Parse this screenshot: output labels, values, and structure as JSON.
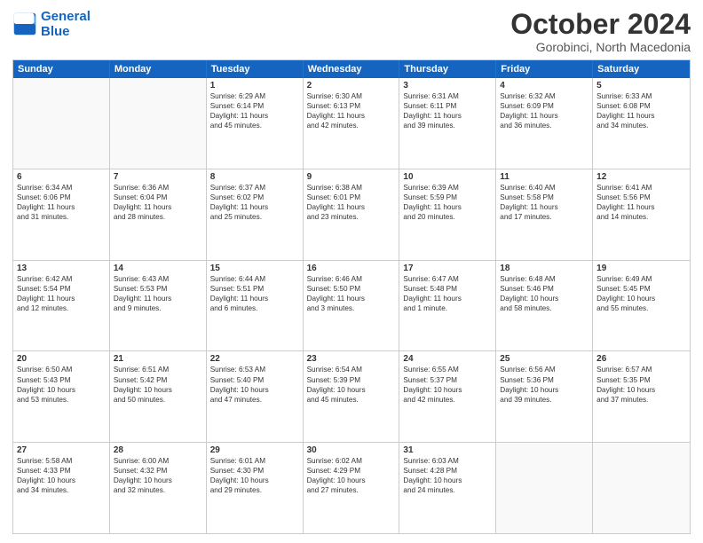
{
  "logo": {
    "line1": "General",
    "line2": "Blue"
  },
  "header": {
    "month": "October 2024",
    "location": "Gorobinci, North Macedonia"
  },
  "weekdays": [
    "Sunday",
    "Monday",
    "Tuesday",
    "Wednesday",
    "Thursday",
    "Friday",
    "Saturday"
  ],
  "rows": [
    [
      {
        "day": "",
        "lines": [],
        "empty": true
      },
      {
        "day": "",
        "lines": [],
        "empty": true
      },
      {
        "day": "1",
        "lines": [
          "Sunrise: 6:29 AM",
          "Sunset: 6:14 PM",
          "Daylight: 11 hours",
          "and 45 minutes."
        ]
      },
      {
        "day": "2",
        "lines": [
          "Sunrise: 6:30 AM",
          "Sunset: 6:13 PM",
          "Daylight: 11 hours",
          "and 42 minutes."
        ]
      },
      {
        "day": "3",
        "lines": [
          "Sunrise: 6:31 AM",
          "Sunset: 6:11 PM",
          "Daylight: 11 hours",
          "and 39 minutes."
        ]
      },
      {
        "day": "4",
        "lines": [
          "Sunrise: 6:32 AM",
          "Sunset: 6:09 PM",
          "Daylight: 11 hours",
          "and 36 minutes."
        ]
      },
      {
        "day": "5",
        "lines": [
          "Sunrise: 6:33 AM",
          "Sunset: 6:08 PM",
          "Daylight: 11 hours",
          "and 34 minutes."
        ]
      }
    ],
    [
      {
        "day": "6",
        "lines": [
          "Sunrise: 6:34 AM",
          "Sunset: 6:06 PM",
          "Daylight: 11 hours",
          "and 31 minutes."
        ]
      },
      {
        "day": "7",
        "lines": [
          "Sunrise: 6:36 AM",
          "Sunset: 6:04 PM",
          "Daylight: 11 hours",
          "and 28 minutes."
        ]
      },
      {
        "day": "8",
        "lines": [
          "Sunrise: 6:37 AM",
          "Sunset: 6:02 PM",
          "Daylight: 11 hours",
          "and 25 minutes."
        ]
      },
      {
        "day": "9",
        "lines": [
          "Sunrise: 6:38 AM",
          "Sunset: 6:01 PM",
          "Daylight: 11 hours",
          "and 23 minutes."
        ]
      },
      {
        "day": "10",
        "lines": [
          "Sunrise: 6:39 AM",
          "Sunset: 5:59 PM",
          "Daylight: 11 hours",
          "and 20 minutes."
        ]
      },
      {
        "day": "11",
        "lines": [
          "Sunrise: 6:40 AM",
          "Sunset: 5:58 PM",
          "Daylight: 11 hours",
          "and 17 minutes."
        ]
      },
      {
        "day": "12",
        "lines": [
          "Sunrise: 6:41 AM",
          "Sunset: 5:56 PM",
          "Daylight: 11 hours",
          "and 14 minutes."
        ]
      }
    ],
    [
      {
        "day": "13",
        "lines": [
          "Sunrise: 6:42 AM",
          "Sunset: 5:54 PM",
          "Daylight: 11 hours",
          "and 12 minutes."
        ]
      },
      {
        "day": "14",
        "lines": [
          "Sunrise: 6:43 AM",
          "Sunset: 5:53 PM",
          "Daylight: 11 hours",
          "and 9 minutes."
        ]
      },
      {
        "day": "15",
        "lines": [
          "Sunrise: 6:44 AM",
          "Sunset: 5:51 PM",
          "Daylight: 11 hours",
          "and 6 minutes."
        ]
      },
      {
        "day": "16",
        "lines": [
          "Sunrise: 6:46 AM",
          "Sunset: 5:50 PM",
          "Daylight: 11 hours",
          "and 3 minutes."
        ]
      },
      {
        "day": "17",
        "lines": [
          "Sunrise: 6:47 AM",
          "Sunset: 5:48 PM",
          "Daylight: 11 hours",
          "and 1 minute."
        ]
      },
      {
        "day": "18",
        "lines": [
          "Sunrise: 6:48 AM",
          "Sunset: 5:46 PM",
          "Daylight: 10 hours",
          "and 58 minutes."
        ]
      },
      {
        "day": "19",
        "lines": [
          "Sunrise: 6:49 AM",
          "Sunset: 5:45 PM",
          "Daylight: 10 hours",
          "and 55 minutes."
        ]
      }
    ],
    [
      {
        "day": "20",
        "lines": [
          "Sunrise: 6:50 AM",
          "Sunset: 5:43 PM",
          "Daylight: 10 hours",
          "and 53 minutes."
        ]
      },
      {
        "day": "21",
        "lines": [
          "Sunrise: 6:51 AM",
          "Sunset: 5:42 PM",
          "Daylight: 10 hours",
          "and 50 minutes."
        ]
      },
      {
        "day": "22",
        "lines": [
          "Sunrise: 6:53 AM",
          "Sunset: 5:40 PM",
          "Daylight: 10 hours",
          "and 47 minutes."
        ]
      },
      {
        "day": "23",
        "lines": [
          "Sunrise: 6:54 AM",
          "Sunset: 5:39 PM",
          "Daylight: 10 hours",
          "and 45 minutes."
        ]
      },
      {
        "day": "24",
        "lines": [
          "Sunrise: 6:55 AM",
          "Sunset: 5:37 PM",
          "Daylight: 10 hours",
          "and 42 minutes."
        ]
      },
      {
        "day": "25",
        "lines": [
          "Sunrise: 6:56 AM",
          "Sunset: 5:36 PM",
          "Daylight: 10 hours",
          "and 39 minutes."
        ]
      },
      {
        "day": "26",
        "lines": [
          "Sunrise: 6:57 AM",
          "Sunset: 5:35 PM",
          "Daylight: 10 hours",
          "and 37 minutes."
        ]
      }
    ],
    [
      {
        "day": "27",
        "lines": [
          "Sunrise: 5:58 AM",
          "Sunset: 4:33 PM",
          "Daylight: 10 hours",
          "and 34 minutes."
        ]
      },
      {
        "day": "28",
        "lines": [
          "Sunrise: 6:00 AM",
          "Sunset: 4:32 PM",
          "Daylight: 10 hours",
          "and 32 minutes."
        ]
      },
      {
        "day": "29",
        "lines": [
          "Sunrise: 6:01 AM",
          "Sunset: 4:30 PM",
          "Daylight: 10 hours",
          "and 29 minutes."
        ]
      },
      {
        "day": "30",
        "lines": [
          "Sunrise: 6:02 AM",
          "Sunset: 4:29 PM",
          "Daylight: 10 hours",
          "and 27 minutes."
        ]
      },
      {
        "day": "31",
        "lines": [
          "Sunrise: 6:03 AM",
          "Sunset: 4:28 PM",
          "Daylight: 10 hours",
          "and 24 minutes."
        ]
      },
      {
        "day": "",
        "lines": [],
        "empty": true
      },
      {
        "day": "",
        "lines": [],
        "empty": true
      }
    ]
  ]
}
